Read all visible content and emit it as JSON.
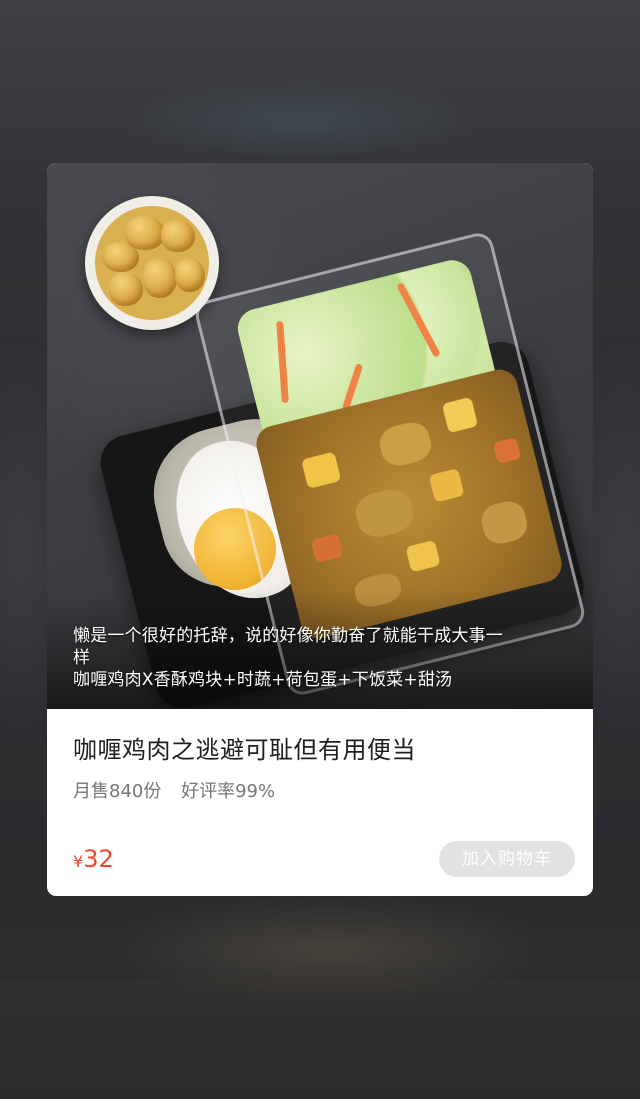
{
  "product": {
    "caption_lines": [
      "懒是一个很好的托辞，说的好像你勤奋了就能干成大事一",
      "样",
      "咖喱鸡肉X香酥鸡块+时蔬+荷包蛋+下饭菜+甜汤"
    ],
    "title": "咖喱鸡肉之逃避可耻但有用便当",
    "monthly_sales": "月售840份",
    "rating": "好评率99%",
    "currency": "¥",
    "price": "32",
    "add_to_cart_label": "加入购物车",
    "add_to_cart_disabled": true
  },
  "colors": {
    "price": "#f0462d",
    "button_bg": "#e2e2e4",
    "card_bg": "#ffffff"
  }
}
